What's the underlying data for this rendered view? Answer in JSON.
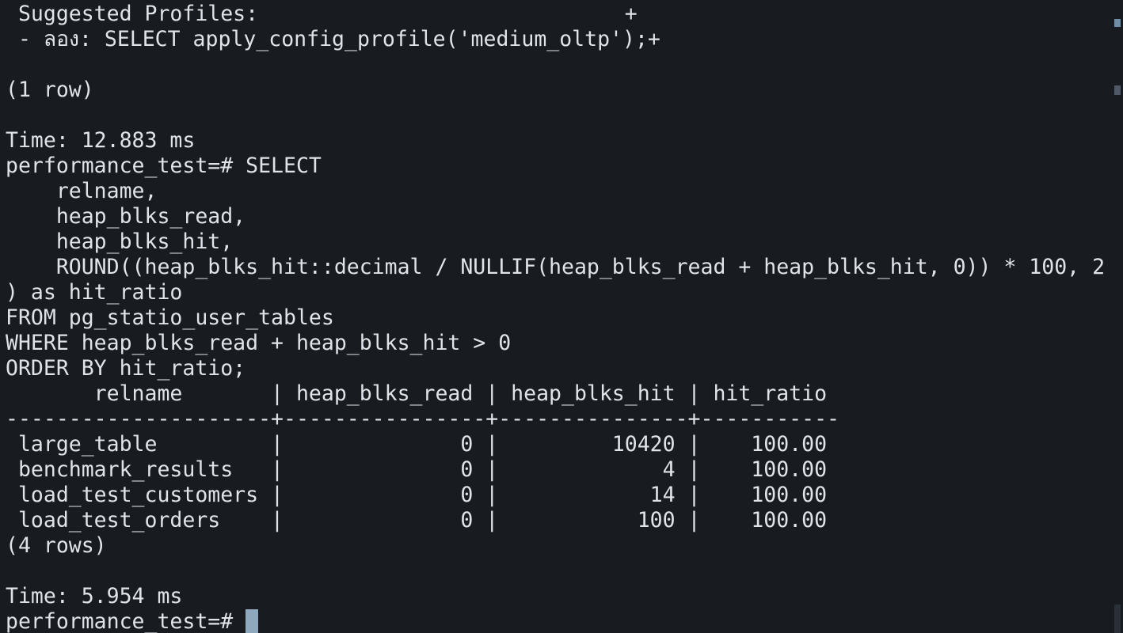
{
  "terminal": {
    "prompt": "performance_test=# ",
    "lines": [
      " Suggested Profiles:                             +",
      " - ลอง: SELECT apply_config_profile('medium_oltp');+",
      "",
      "(1 row)",
      "",
      "Time: 12.883 ms",
      "performance_test=# SELECT",
      "    relname,",
      "    heap_blks_read,",
      "    heap_blks_hit,",
      "    ROUND((heap_blks_hit::decimal / NULLIF(heap_blks_read + heap_blks_hit, 0)) * 100, 2",
      ") as hit_ratio",
      "FROM pg_statio_user_tables",
      "WHERE heap_blks_read + heap_blks_hit > 0",
      "ORDER BY hit_ratio;",
      "       relname       | heap_blks_read | heap_blks_hit | hit_ratio",
      "---------------------+----------------+---------------+-----------",
      " large_table         |              0 |         10420 |    100.00",
      " benchmark_results   |              0 |             4 |    100.00",
      " load_test_customers |              0 |            14 |    100.00",
      " load_test_orders    |              0 |           100 |    100.00",
      "(4 rows)",
      "",
      "Time: 5.954 ms"
    ]
  }
}
